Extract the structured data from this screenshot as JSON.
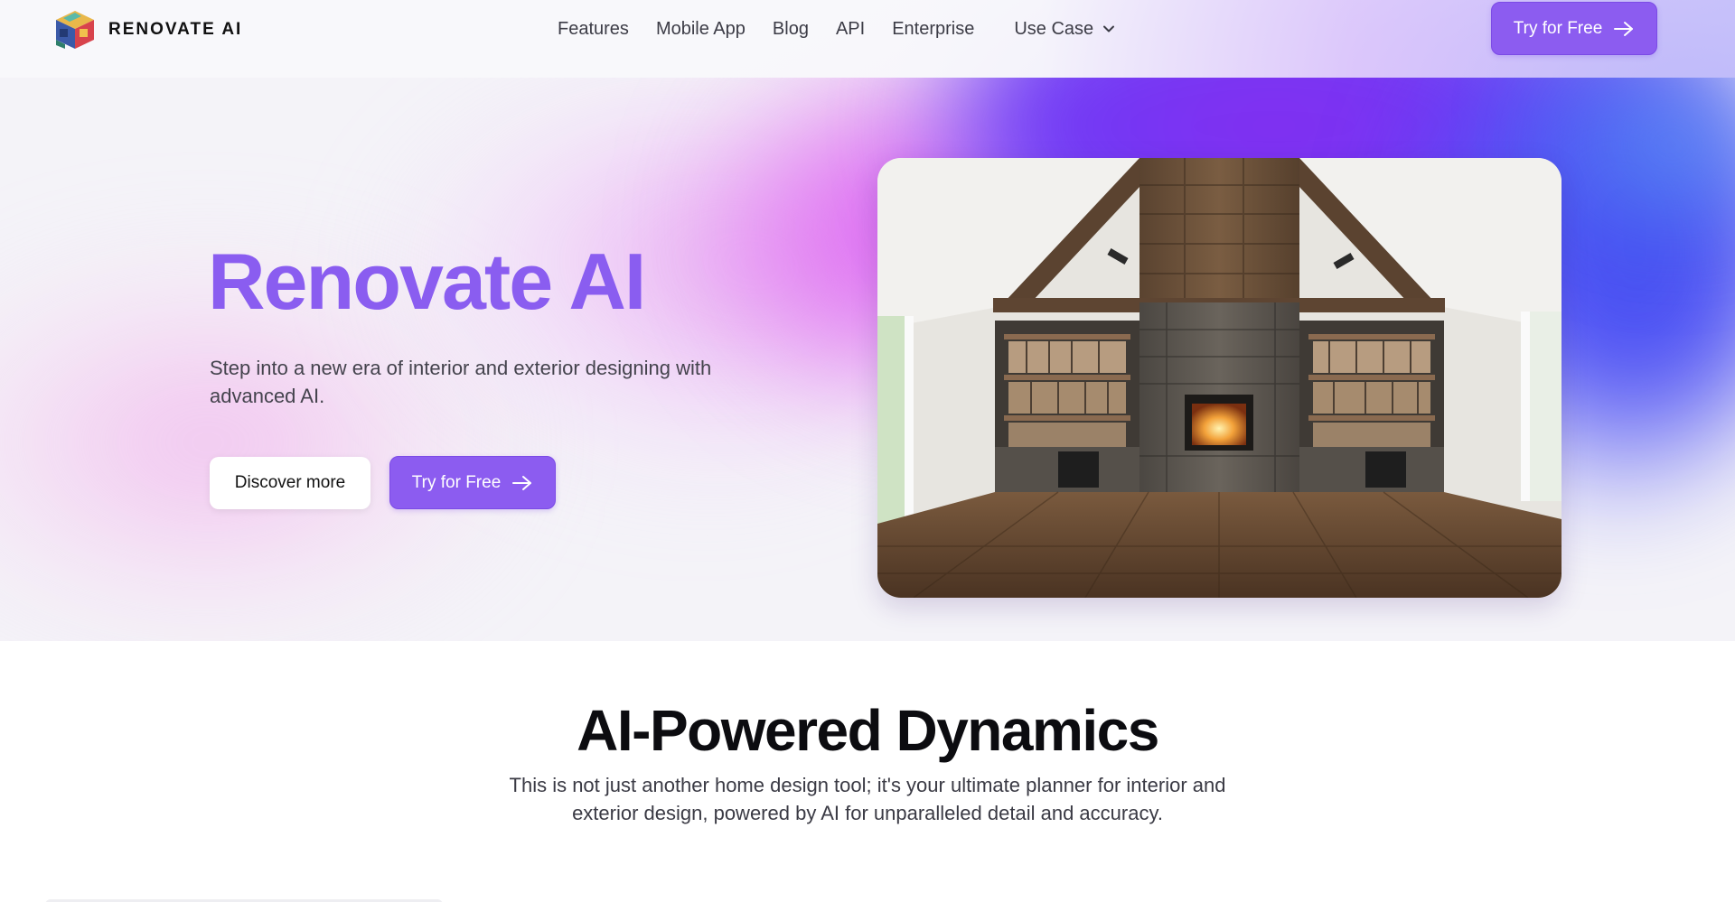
{
  "header": {
    "brand": "RENOVATE AI",
    "logo_icon": "cube-logo-icon",
    "nav": [
      "Features",
      "Mobile App",
      "Blog",
      "API",
      "Enterprise"
    ],
    "use_case_label": "Use Case",
    "cta_label": "Try for Free"
  },
  "hero": {
    "title": "Renovate AI",
    "subtitle": "Step into a new era of interior and exterior designing with advanced AI.",
    "discover_label": "Discover more",
    "cta_label": "Try for Free",
    "image_icon": "living-room-fireplace-photo"
  },
  "dynamics": {
    "title": "AI-Powered Dynamics",
    "description": "This is not just another home design tool; it's your ultimate planner for interior and exterior design, powered by AI for unparalleled detail and accuracy."
  },
  "colors": {
    "accent": "#8c5cf0",
    "title_purple": "#8a5df0",
    "glow_magenta": "#d74df2",
    "glow_blue": "#4f52f4"
  }
}
